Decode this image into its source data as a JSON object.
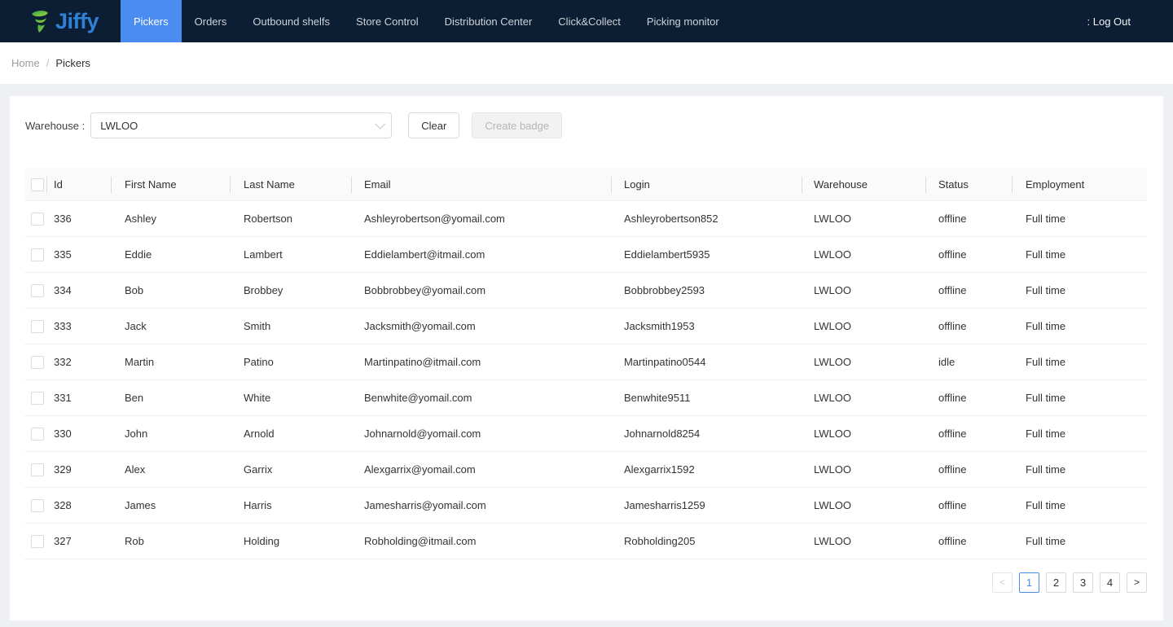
{
  "nav": {
    "logo_text": "Jiffy",
    "items": [
      {
        "label": "Pickers",
        "active": true
      },
      {
        "label": "Orders",
        "active": false
      },
      {
        "label": "Outbound shelfs",
        "active": false
      },
      {
        "label": "Store Control",
        "active": false
      },
      {
        "label": "Distribution Center",
        "active": false
      },
      {
        "label": "Click&Collect",
        "active": false
      },
      {
        "label": "Picking monitor",
        "active": false
      }
    ],
    "logout_label": ": Log Out"
  },
  "breadcrumb": {
    "home": "Home",
    "separator": "/",
    "current": "Pickers"
  },
  "filters": {
    "warehouse_label": "Warehouse :",
    "warehouse_value": "LWLOO",
    "clear_label": "Clear",
    "create_badge_label": "Create badge"
  },
  "table": {
    "columns": [
      "Id",
      "First Name",
      "Last Name",
      "Email",
      "Login",
      "Warehouse",
      "Status",
      "Employment"
    ],
    "rows": [
      {
        "id": "336",
        "first": "Ashley",
        "last": "Robertson",
        "email": "Ashleyrobertson@yomail.com",
        "login": "Ashleyrobertson852",
        "warehouse": "LWLOO",
        "status": "offline",
        "employment": "Full time"
      },
      {
        "id": "335",
        "first": "Eddie",
        "last": "Lambert",
        "email": "Eddielambert@itmail.com",
        "login": "Eddielambert5935",
        "warehouse": "LWLOO",
        "status": "offline",
        "employment": "Full time"
      },
      {
        "id": "334",
        "first": "Bob",
        "last": "Brobbey",
        "email": "Bobbrobbey@yomail.com",
        "login": "Bobbrobbey2593",
        "warehouse": "LWLOO",
        "status": "offline",
        "employment": "Full time"
      },
      {
        "id": "333",
        "first": "Jack",
        "last": "Smith",
        "email": "Jacksmith@yomail.com",
        "login": "Jacksmith1953",
        "warehouse": "LWLOO",
        "status": "offline",
        "employment": "Full time"
      },
      {
        "id": "332",
        "first": "Martin",
        "last": "Patino",
        "email": "Martinpatino@itmail.com",
        "login": "Martinpatino0544",
        "warehouse": "LWLOO",
        "status": "idle",
        "employment": "Full time"
      },
      {
        "id": "331",
        "first": "Ben",
        "last": "White",
        "email": "Benwhite@yomail.com",
        "login": "Benwhite9511",
        "warehouse": "LWLOO",
        "status": "offline",
        "employment": "Full time"
      },
      {
        "id": "330",
        "first": "John",
        "last": "Arnold",
        "email": "Johnarnold@yomail.com",
        "login": "Johnarnold8254",
        "warehouse": "LWLOO",
        "status": "offline",
        "employment": "Full time"
      },
      {
        "id": "329",
        "first": "Alex",
        "last": "Garrix",
        "email": "Alexgarrix@yomail.com",
        "login": "Alexgarrix1592",
        "warehouse": "LWLOO",
        "status": "offline",
        "employment": "Full time"
      },
      {
        "id": "328",
        "first": "James",
        "last": "Harris",
        "email": "Jamesharris@yomail.com",
        "login": "Jamesharris1259",
        "warehouse": "LWLOO",
        "status": "offline",
        "employment": "Full time"
      },
      {
        "id": "327",
        "first": "Rob",
        "last": "Holding",
        "email": "Robholding@itmail.com",
        "login": "Robholding205",
        "warehouse": "LWLOO",
        "status": "offline",
        "employment": "Full time"
      }
    ]
  },
  "pagination": {
    "prev_icon": "<",
    "next_icon": ">",
    "pages": [
      "1",
      "2",
      "3",
      "4"
    ],
    "active_page": "1"
  },
  "colors": {
    "nav_bg": "#0c1e33",
    "accent_blue": "#4a8cf0",
    "logo_blue": "#2e80d8",
    "logo_green": "#4fb83e",
    "page_bg": "#eef0f4"
  }
}
